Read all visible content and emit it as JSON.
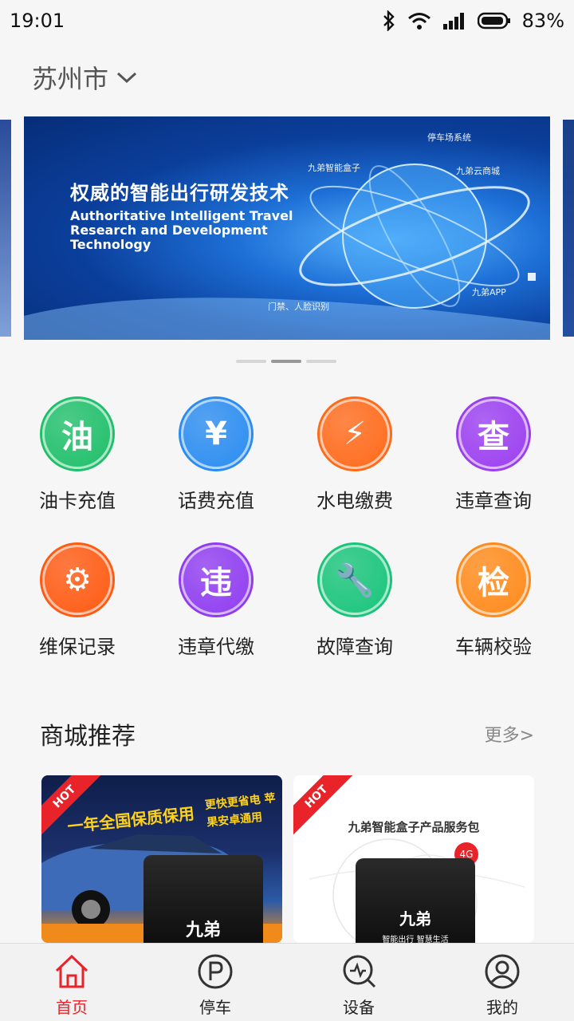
{
  "status_bar": {
    "time": "19:01",
    "battery": "83%"
  },
  "location": {
    "city": "苏州市"
  },
  "banner": {
    "title_cn": "权威的智能出行研发技术",
    "title_en": "Authoritative Intelligent Travel Research and Development Technology",
    "tags": [
      "停车场系统",
      "九弟智能盒子",
      "九弟云商城",
      "九弟APP",
      "门禁、人脸识别"
    ],
    "page_index": 2,
    "page_count": 3
  },
  "services": [
    {
      "icon_char": "油",
      "label": "油卡充值",
      "color": "#1fbf6a"
    },
    {
      "icon_char": "¥",
      "label": "话费充值",
      "color": "#2a8cf0"
    },
    {
      "icon_char": "⚡",
      "label": "水电缴费",
      "color": "#ff6a1a"
    },
    {
      "icon_char": "查",
      "label": "违章查询",
      "color": "#9b3ef0"
    },
    {
      "icon_char": "⚙",
      "label": "维保记录",
      "color": "#ff5a12"
    },
    {
      "icon_char": "违",
      "label": "违章代缴",
      "color": "#8f3cf0"
    },
    {
      "icon_char": "🔧",
      "label": "故障查询",
      "color": "#18c47a"
    },
    {
      "icon_char": "检",
      "label": "车辆校验",
      "color": "#ff8a1a"
    }
  ],
  "mall": {
    "title": "商城推荐",
    "more": "更多>",
    "cards": [
      {
        "hot": "HOT",
        "headline": "一年全国保质保用",
        "subline": "更快更省电 苹果安卓通用",
        "brand": "九弟"
      },
      {
        "hot": "HOT",
        "headline": "九弟智能盒子产品服务包",
        "badge": "4G",
        "brand": "九弟",
        "slogan": "智能出行 智慧生活"
      }
    ]
  },
  "tabbar": [
    {
      "label": "首页",
      "icon": "home-icon",
      "active": true
    },
    {
      "label": "停车",
      "icon": "parking-icon",
      "active": false
    },
    {
      "label": "设备",
      "icon": "device-search-icon",
      "active": false
    },
    {
      "label": "我的",
      "icon": "profile-icon",
      "active": false
    }
  ]
}
